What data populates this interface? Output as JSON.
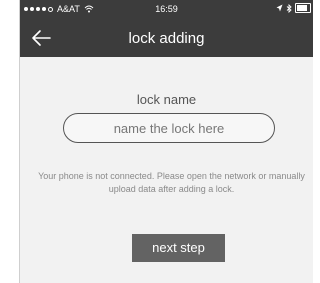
{
  "status_bar": {
    "carrier": "A&AT",
    "time": "16:59",
    "signal_icon": "signal-dots-icon",
    "wifi_icon": "wifi-icon",
    "location_icon": "location-arrow-icon",
    "bluetooth_icon": "bluetooth-icon",
    "battery_icon": "battery-icon",
    "signal_bars_filled": 4,
    "signal_bars_total": 5,
    "battery_level": 0.85
  },
  "nav": {
    "title": "lock adding",
    "back_icon": "back-arrow-icon"
  },
  "form": {
    "label": "lock name",
    "placeholder": "name the lock here",
    "value": ""
  },
  "notice": "Your phone is not connected. Please open the network or manually upload data after adding a lock.",
  "next_button": "next step",
  "colors": {
    "header_bg": "#3c3c3c",
    "body_bg": "#f2f2f2",
    "button_bg": "#636363",
    "notice_text": "#8a8a8a"
  }
}
